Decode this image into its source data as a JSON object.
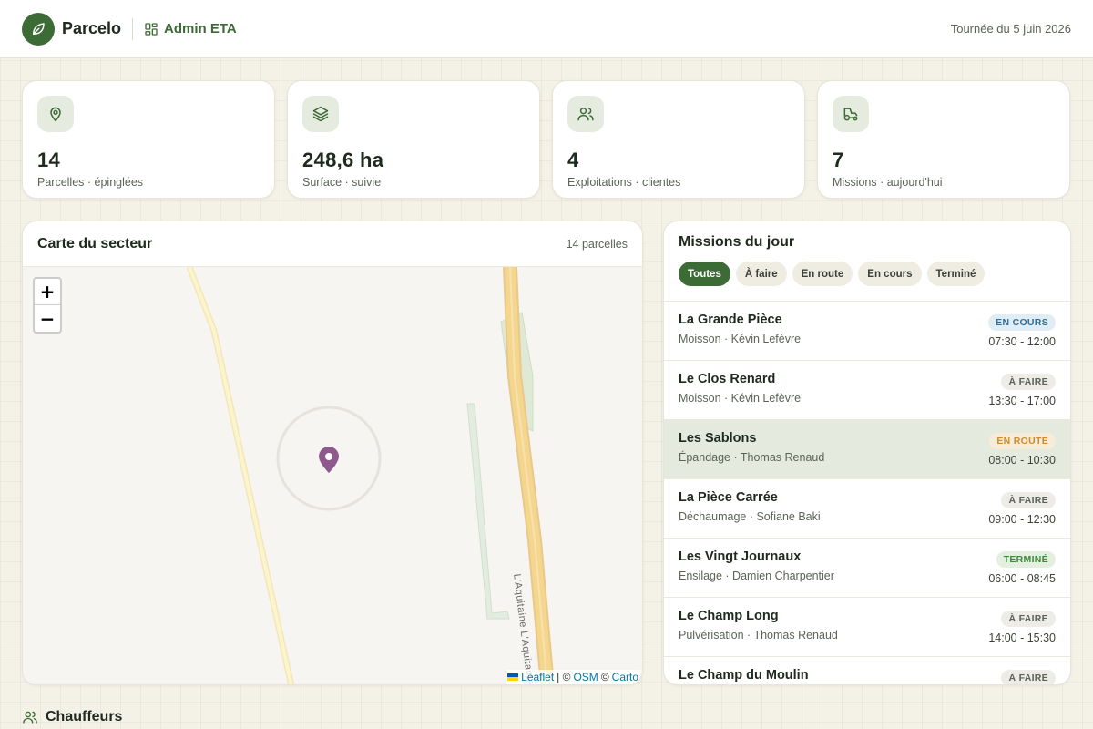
{
  "header": {
    "brand": "Parcelo",
    "admin_label": "Admin ETA",
    "date": "Tournée du 5 juin 2026"
  },
  "stats": [
    {
      "icon": "map-pin-icon",
      "value": "14",
      "label": "Parcelles · épinglées"
    },
    {
      "icon": "layers-icon",
      "value": "248,6 ha",
      "label": "Surface · suivie"
    },
    {
      "icon": "users-icon",
      "value": "4",
      "label": "Exploitations · clientes"
    },
    {
      "icon": "tractor-icon",
      "value": "7",
      "label": "Missions · aujourd'hui"
    }
  ],
  "map": {
    "title": "Carte du secteur",
    "count": "14 parcelles",
    "zoom_in": "+",
    "zoom_out": "−",
    "road_label": "L'Aquitaine L'Aquitaine",
    "attribution": {
      "leaflet": "Leaflet",
      "sep1": "| ©",
      "osm": "OSM",
      "sep2": "©",
      "carto": "Carto"
    }
  },
  "missions": {
    "title": "Missions du jour",
    "filters": [
      "Toutes",
      "À faire",
      "En route",
      "En cours",
      "Terminé"
    ],
    "active_filter": "Toutes",
    "items": [
      {
        "name": "La Grande Pièce",
        "sub": "Moisson · Kévin Lefèvre",
        "status": "EN COURS",
        "time": "07:30 - 12:00",
        "badge_bg": "#e1edf5",
        "badge_fg": "#2f6f9c"
      },
      {
        "name": "Le Clos Renard",
        "sub": "Moisson · Kévin Lefèvre",
        "status": "À FAIRE",
        "time": "13:30 - 17:00",
        "badge_bg": "#eeece6",
        "badge_fg": "#5b6357"
      },
      {
        "name": "Les Sablons",
        "sub": "Épandage · Thomas Renaud",
        "status": "EN ROUTE",
        "time": "08:00 - 10:30",
        "badge_bg": "#f7ecd8",
        "badge_fg": "#d08a2a"
      },
      {
        "name": "La Pièce Carrée",
        "sub": "Déchaumage · Sofiane Baki",
        "status": "À FAIRE",
        "time": "09:00 - 12:30",
        "badge_bg": "#eeece6",
        "badge_fg": "#5b6357"
      },
      {
        "name": "Les Vingt Journaux",
        "sub": "Ensilage · Damien Charpentier",
        "status": "TERMINÉ",
        "time": "06:00 - 08:45",
        "badge_bg": "#e3f0df",
        "badge_fg": "#3d8a3a"
      },
      {
        "name": "Le Champ Long",
        "sub": "Pulvérisation · Thomas Renaud",
        "status": "À FAIRE",
        "time": "14:00 - 15:30",
        "badge_bg": "#eeece6",
        "badge_fg": "#5b6357"
      },
      {
        "name": "Le Champ du Moulin",
        "sub": "",
        "status": "À FAIRE",
        "time": "",
        "badge_bg": "#eeece6",
        "badge_fg": "#5b6357"
      }
    ],
    "highlighted_index": 2
  },
  "drivers": {
    "title": "Chauffeurs"
  },
  "colors": {
    "brand_green": "#3d6b35",
    "pin_purple": "#8e5a8e"
  }
}
